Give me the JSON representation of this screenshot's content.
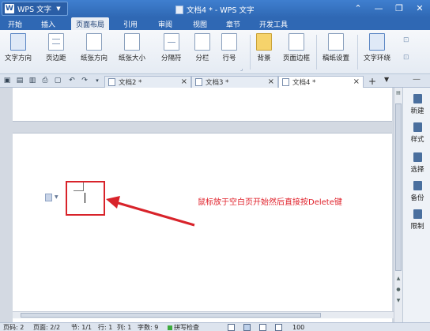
{
  "app": {
    "name": "WPS 文字",
    "title": "文档4 * - WPS 文字"
  },
  "window_controls": {
    "ribbon_toggle": "⌃",
    "minimize": "—",
    "restore": "❐",
    "close": "✕"
  },
  "menu": [
    "开始",
    "插入",
    "页面布局",
    "引用",
    "审阅",
    "视图",
    "章节",
    "开发工具"
  ],
  "ribbon": {
    "text_direction": "文字方向",
    "margins": "页边距",
    "orientation": "纸张方向",
    "size": "纸张大小",
    "separators": "分隔符",
    "columns": "分栏",
    "line_numbers": "行号",
    "background": "背景",
    "page_border": "页面边框",
    "draft_paper": "稿纸设置",
    "wrap_text": "文字环绕"
  },
  "tabs": [
    {
      "label": "文档2 *",
      "active": false
    },
    {
      "label": "文档3 *",
      "active": false
    },
    {
      "label": "文档4 *",
      "active": true
    }
  ],
  "tab_controls": {
    "add": "+",
    "list": "▼"
  },
  "side_panel": [
    "新建",
    "样式",
    "选择",
    "备份",
    "限制"
  ],
  "annotation": "鼠标放于空白页开始然后直接按Delete键",
  "status": {
    "page": "页码: 2",
    "pages": "页面: 2/2",
    "section": "节: 1/1",
    "row": "行: 1",
    "col": "列: 1",
    "words": "字数: 9",
    "spell": "拼写检查",
    "zoom": "100"
  },
  "colors": {
    "title_bar": "#2f68b4",
    "annotation_red": "#d8232a",
    "ribbon_bg": "#f1f4f9"
  }
}
